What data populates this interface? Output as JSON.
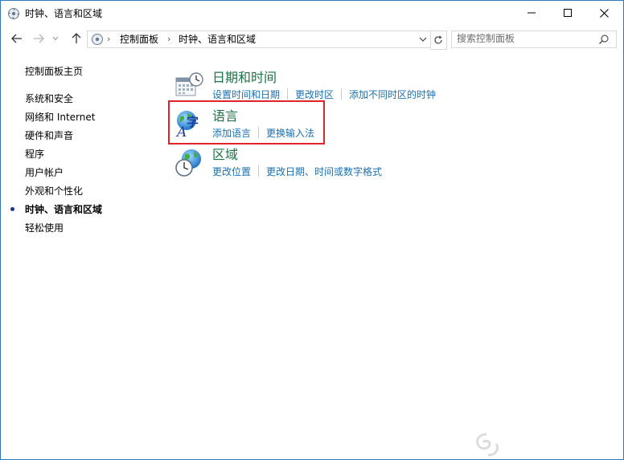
{
  "window": {
    "title": "时钟、语言和区域",
    "controls": {
      "minimize": "minimize",
      "maximize": "maximize",
      "close": "close"
    }
  },
  "address_bar": {
    "crumbs": [
      "控制面板",
      "时钟、语言和区域"
    ],
    "search_placeholder": "搜索控制面板"
  },
  "sidebar": {
    "home": "控制面板主页",
    "items": [
      {
        "label": "系统和安全",
        "active": false
      },
      {
        "label": "网络和 Internet",
        "active": false
      },
      {
        "label": "硬件和声音",
        "active": false
      },
      {
        "label": "程序",
        "active": false
      },
      {
        "label": "用户帐户",
        "active": false
      },
      {
        "label": "外观和个性化",
        "active": false
      },
      {
        "label": "时钟、语言和区域",
        "active": true
      },
      {
        "label": "轻松使用",
        "active": false
      }
    ]
  },
  "categories": [
    {
      "title": "日期和时间",
      "icon": "calendar-clock-icon",
      "links": [
        "设置时间和日期",
        "更改时区",
        "添加不同时区的时钟"
      ]
    },
    {
      "title": "语言",
      "icon": "language-globe-icon",
      "links": [
        "添加语言",
        "更换输入法"
      ]
    },
    {
      "title": "区域",
      "icon": "region-globe-clock-icon",
      "links": [
        "更改位置",
        "更改日期、时间或数字格式"
      ]
    }
  ],
  "colors": {
    "category_title": "#1e7145",
    "link": "#1e6fae",
    "highlight_box": "#e0242a",
    "window_border": "#2b78c5"
  }
}
